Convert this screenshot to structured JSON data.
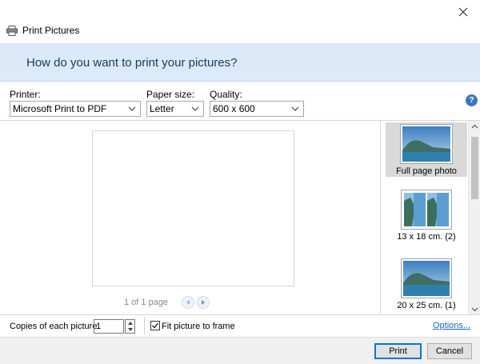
{
  "window": {
    "title": "Print Pictures",
    "close_label": "✕"
  },
  "banner": {
    "heading": "How do you want to print your pictures?"
  },
  "options": {
    "printer": {
      "label": "Printer:",
      "value": "Microsoft Print to PDF"
    },
    "paper_size": {
      "label": "Paper size:",
      "value": "Letter"
    },
    "quality": {
      "label": "Quality:",
      "value": "600 x 600"
    },
    "help_label": "?"
  },
  "preview": {
    "page_info": "1 of 1 page"
  },
  "layouts": [
    {
      "label": "Full page photo",
      "selected": true
    },
    {
      "label": "13 x 18 cm. (2)",
      "selected": false
    },
    {
      "label": "20 x 25 cm. (1)",
      "selected": false
    }
  ],
  "bottom": {
    "copies_label": "Copies of each picture:",
    "copies_value": "1",
    "fit_label": "Fit picture to frame",
    "fit_checked": true,
    "options_link": "Options..."
  },
  "footer": {
    "print_label": "Print",
    "cancel_label": "Cancel"
  },
  "colors": {
    "banner_bg": "#dce9f8",
    "link": "#1a66b8",
    "accent": "#0078d7"
  }
}
